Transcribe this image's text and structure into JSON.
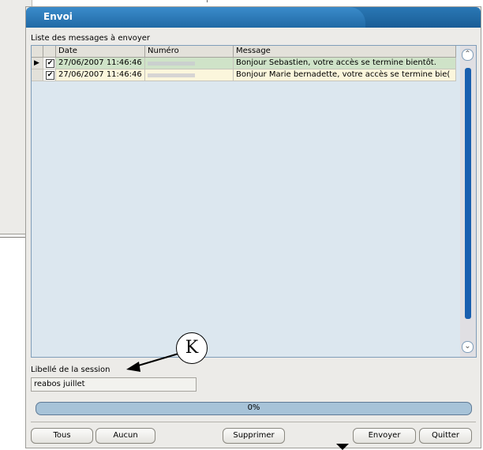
{
  "dialog": {
    "title": "Envoi",
    "list_label": "Liste des messages à envoyer"
  },
  "grid": {
    "headers": [
      "Date",
      "Numéro",
      "Message"
    ],
    "rows": [
      {
        "checked": "✔",
        "date": "27/06/2007 11:46:46",
        "numero": "",
        "message": "Bonjour Sebastien, votre accès se termine bientôt.",
        "current": true,
        "bg": "#cfe3c8"
      },
      {
        "checked": "✔",
        "date": "27/06/2007 11:46:46",
        "numero": "",
        "message": "Bonjour Marie bernadette, votre accès se termine bie(",
        "current": false,
        "bg": "#fbf6dc"
      }
    ]
  },
  "session": {
    "label": "Libellé de la session",
    "value": "reabos juillet"
  },
  "progress": {
    "text": "0%",
    "value": 0
  },
  "buttons": {
    "tous": "Tous",
    "aucun": "Aucun",
    "supprimer": "Supprimer",
    "envoyer": "Envoyer",
    "quitter": "Quitter"
  },
  "annotation": {
    "marker": "K"
  },
  "colors": {
    "title_bar": "#2a78b5",
    "scroll_thumb": "#1a5fae",
    "grid_bg": "#dce7ef"
  }
}
